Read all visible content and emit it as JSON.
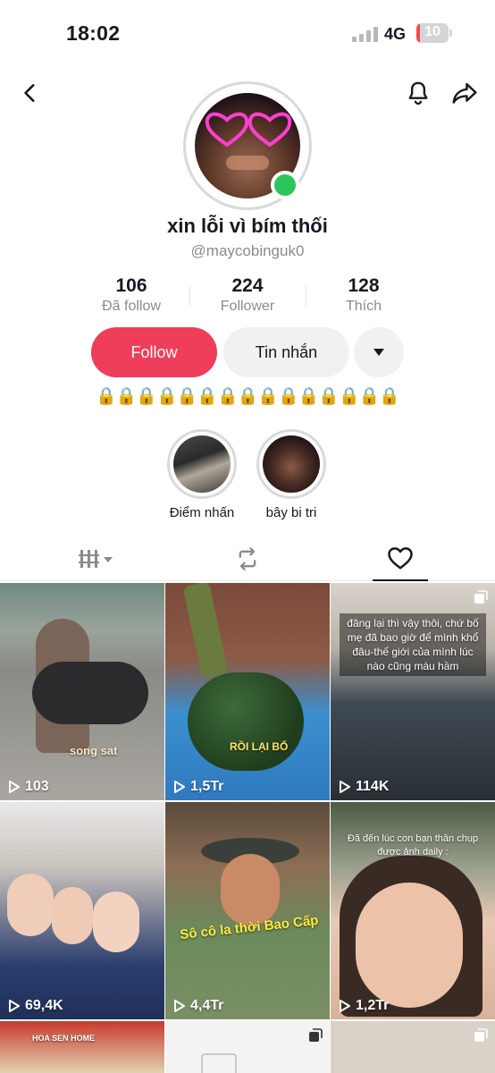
{
  "status_bar": {
    "time": "18:02",
    "network": "4G",
    "battery": "10",
    "battery_level": 0.1
  },
  "profile": {
    "display_name": "xin lỗi vì bím thối",
    "username": "@maycobinguk0",
    "stats": [
      {
        "value": "106",
        "label": "Đã follow"
      },
      {
        "value": "224",
        "label": "Follower"
      },
      {
        "value": "128",
        "label": "Thích"
      }
    ],
    "follow_label": "Follow",
    "message_label": "Tin nhắn",
    "bio": "🔒🔒🔒🔒🔒🔒🔒🔒🔒🔒🔒🔒🔒🔒🔒",
    "online_color": "#2bc65a"
  },
  "highlights": [
    {
      "label": "Điểm nhấn"
    },
    {
      "label": "bây bi tri"
    }
  ],
  "tabs": [
    {
      "icon": "grid-icon"
    },
    {
      "icon": "repost-icon"
    },
    {
      "icon": "heart-icon",
      "active": true
    }
  ],
  "videos": [
    {
      "views": "103",
      "caption": "song sat"
    },
    {
      "views": "1,5Tr",
      "caption": "RỒI LẠI BỔ"
    },
    {
      "views": "114K",
      "caption": "đăng lại thì vậy thôi, chứ bố mẹ đã bao giờ để mình khổ đâu-thế giới của mình lúc nào cũng màu hầm"
    },
    {
      "views": "69,4K",
      "caption": ""
    },
    {
      "views": "4,4Tr",
      "caption": "Sô cô la thời Bao Cấp"
    },
    {
      "views": "1,2Tr",
      "caption": "Đã đến lúc con bạn thân chụp được ảnh daily :"
    },
    {
      "views": "",
      "caption": "HOA SEN HOME"
    },
    {
      "views": "",
      "caption": ""
    },
    {
      "views": "",
      "caption": ""
    }
  ],
  "colors": {
    "accent": "#ee3e5a",
    "muted": "#8a8b91",
    "text": "#161823"
  }
}
